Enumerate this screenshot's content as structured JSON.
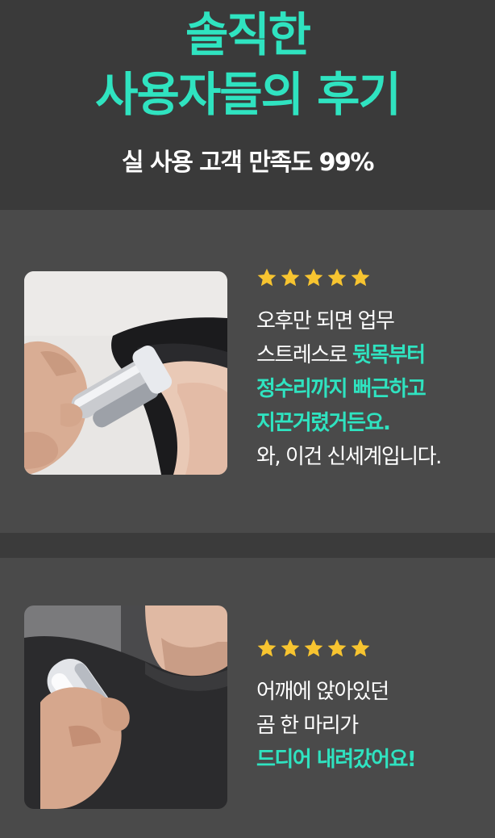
{
  "header": {
    "title_line1": "솔직한",
    "title_line2": "사용자들의 후기",
    "subtitle": "실 사용 고객 만족도 99%"
  },
  "colors": {
    "accent": "#2fe3c0",
    "star": "#f7c430",
    "card_bg": "#4a4a4a",
    "page_bg": "#3a3a3a"
  },
  "reviews": [
    {
      "rating": 5,
      "photo": "hair-massage-photo",
      "lines": [
        {
          "plain": "오후만 되면 업무",
          "highlight": ""
        },
        {
          "plain": "스트레스로 ",
          "highlight": "뒷목부터"
        },
        {
          "plain": "",
          "highlight": "정수리까지 뻐근하고"
        },
        {
          "plain": "",
          "highlight": "지끈거렸거든요."
        },
        {
          "plain": "와, 이건 신세계입니다.",
          "highlight": ""
        }
      ]
    },
    {
      "rating": 5,
      "photo": "shoulder-massage-photo",
      "lines": [
        {
          "plain": "어깨에 앉아있던",
          "highlight": ""
        },
        {
          "plain": "곰 한 마리가",
          "highlight": ""
        },
        {
          "plain": "",
          "highlight": "드디어 내려갔어요!"
        }
      ]
    }
  ]
}
